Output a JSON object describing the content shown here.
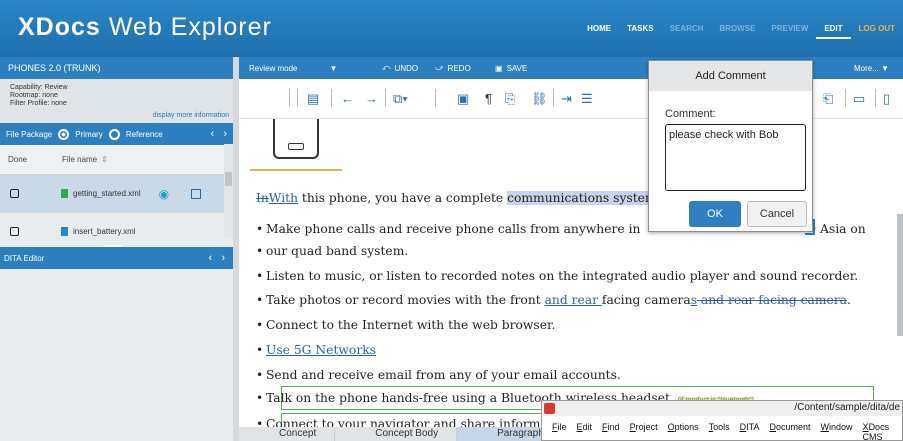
{
  "app": {
    "title_bold": "XDocs",
    "title_rest": "Web Explorer"
  },
  "nav": [
    "HOME",
    "TASKS",
    "SEARCH",
    "BROWSE",
    "PREVIEW",
    "EDIT",
    "LOG OUT"
  ],
  "project": {
    "name": "PHONES 2.0 (TRUNK)",
    "capability": "Capability: Review",
    "rootmap": "Rootmap: none",
    "filter": "Filter Profile: none",
    "more_info": "display more information"
  },
  "file_package": {
    "label": "File Package",
    "primary": "Primary",
    "reference": "Reference",
    "col_done": "Done",
    "col_name": "File name",
    "files": [
      "getting_started.xml",
      "insert_battery.xml"
    ]
  },
  "dita_editor": {
    "label": "DITA Editor"
  },
  "toolbar": {
    "mode": "Review mode",
    "undo": "UNDO",
    "redo": "REDO",
    "save": "SAVE",
    "more": "More..."
  },
  "doc": {
    "p1_deleted": "In",
    "p1_inserted": "With",
    "p1_text": " this phone, you have a complete ",
    "p1_hl": "communications system",
    "b1": "Make phone calls and receive phone calls from anywhere in",
    "b1_end": "Asia on",
    "b1_cont": "our quad band system.",
    "b2": "Listen to music, or listen to recorded notes on the integrated audio player and sound recorder.",
    "b3_a": "Take photos or record movies with the front ",
    "b3_ins": "and rear ",
    "b3_b": "facing camera",
    "b3_ins2": "s",
    "b3_del": " and rear facing camera",
    "b3_c": ".",
    "b4": "Connect to the Internet with the web browser.",
    "b5": "Use 5G Networks",
    "b6": "Send and receive email from any of your email accounts.",
    "b7": "Talk on the phone hands-free using a Bluetooth wireless headset.",
    "b7_tag": "(if product is \"bluetooth\")",
    "b8": "Connect to your navigator and share inform"
  },
  "crumbs": [
    "Concept",
    "Concept Body",
    "Paragraph"
  ],
  "dialog": {
    "title": "Add Comment",
    "label": "Comment:",
    "value": "please check with Bob",
    "ok": "OK",
    "cancel": "Cancel"
  },
  "oxygen": {
    "path": "/Content/sample/dita/de",
    "menu": [
      "File",
      "Edit",
      "Find",
      "Project",
      "Options",
      "Tools",
      "DITA",
      "Document",
      "Window",
      "XDocs CMS"
    ]
  },
  "colors": {
    "header": "#2a86c7",
    "bar": "#2d80bf",
    "accent": "#f2b13c",
    "track_change": "#2a5fa8"
  }
}
